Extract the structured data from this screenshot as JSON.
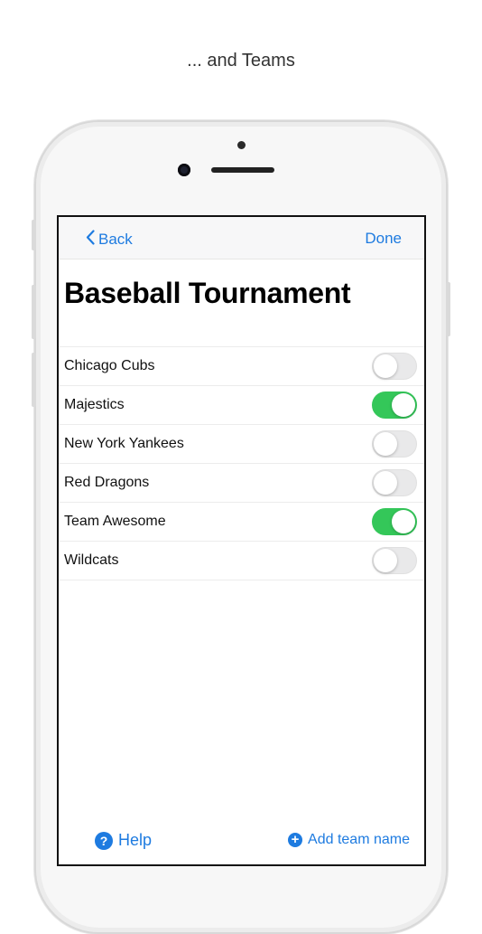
{
  "caption": "... and Teams",
  "nav": {
    "back_label": "Back",
    "done_label": "Done"
  },
  "page_title": "Baseball Tournament",
  "teams": [
    {
      "name": "Chicago Cubs",
      "enabled": false
    },
    {
      "name": "Majestics",
      "enabled": true
    },
    {
      "name": "New York Yankees",
      "enabled": false
    },
    {
      "name": "Red Dragons",
      "enabled": false
    },
    {
      "name": "Team Awesome",
      "enabled": true
    },
    {
      "name": "Wildcats",
      "enabled": false
    }
  ],
  "footer": {
    "help_label": "Help",
    "help_icon": "question-circle-icon",
    "add_label": "Add team name",
    "add_icon": "plus-circle-icon"
  },
  "colors": {
    "accent": "#1e7be0",
    "toggle_on": "#34c759",
    "toggle_off": "#e9e9ea"
  }
}
